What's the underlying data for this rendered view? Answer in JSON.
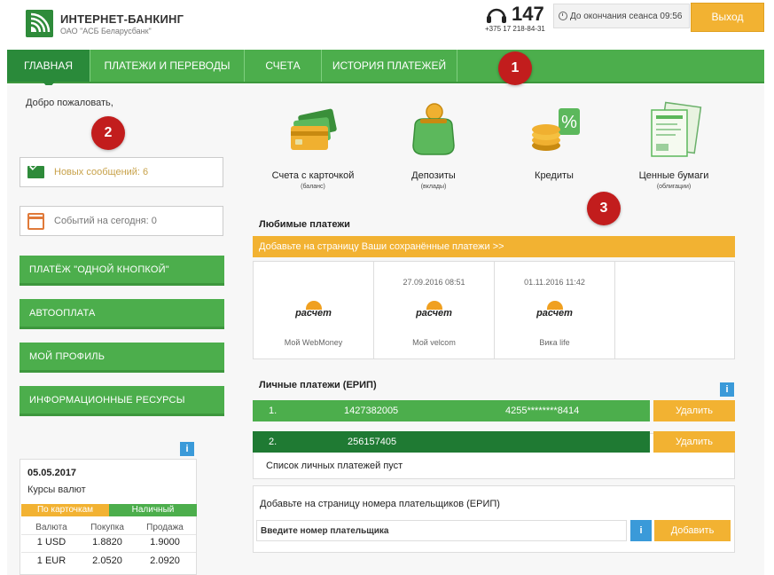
{
  "header": {
    "brand_title": "ИНТЕРНЕТ-БАНКИНГ",
    "brand_subtitle": "ОАО \"АСБ Беларусбанк\"",
    "phone_short": "147",
    "phone_full": "+375 17 218-84-31",
    "session_label": "До окончания сеанса 09:56",
    "logout_label": "Выход"
  },
  "nav": {
    "items": [
      {
        "label": "ГЛАВНАЯ",
        "active": true
      },
      {
        "label": "ПЛАТЕЖИ И ПЕРЕВОДЫ"
      },
      {
        "label": "СЧЕТА"
      },
      {
        "label": "ИСТОРИЯ ПЛАТЕЖЕЙ"
      }
    ]
  },
  "annotations": [
    "1",
    "2",
    "3"
  ],
  "sidebar": {
    "welcome": "Добро пожаловать,",
    "messages": "Новых сообщений: 6",
    "events": "Событий на сегодня: 0",
    "buttons": [
      "ПЛАТЁЖ \"ОДНОЙ КНОПКОЙ\"",
      "АВТООПЛАТА",
      "МОЙ ПРОФИЛЬ",
      "ИНФОРМАЦИОННЫЕ РЕСУРСЫ"
    ],
    "info_label": "i"
  },
  "currency": {
    "date": "05.05.2017",
    "title": "Курсы валют",
    "tab_card": "По карточкам",
    "tab_cash": "Наличный",
    "headers": [
      "Валюта",
      "Покупка",
      "Продажа"
    ],
    "rows": [
      {
        "cur": "1 USD",
        "buy": "1.8820",
        "sell": "1.9000"
      },
      {
        "cur": "1 EUR",
        "buy": "2.0520",
        "sell": "2.0920"
      }
    ]
  },
  "products": [
    {
      "label": "Счета с карточкой",
      "sub": "(баланс)",
      "icon": "credit-cards-icon"
    },
    {
      "label": "Депозиты",
      "sub": "(вклады)",
      "icon": "coin-purse-icon"
    },
    {
      "label": "Кредиты",
      "sub": "",
      "icon": "coins-percent-icon"
    },
    {
      "label": "Ценные бумаги",
      "sub": "(облигации)",
      "icon": "securities-icon"
    }
  ],
  "favorites": {
    "title": "Любимые платежи",
    "add_bar": "Добавьте на страницу Ваши сохранённые платежи >>",
    "logo_text": "расчет",
    "items": [
      {
        "date": "",
        "name": "Мой WebMoney"
      },
      {
        "date": "27.09.2016 08:51",
        "name": "Мой velcom"
      },
      {
        "date": "01.11.2016 11:42",
        "name": "Вика life"
      }
    ]
  },
  "erip": {
    "title": "Личные платежи (ЕРИП)",
    "rows": [
      {
        "num": "1.",
        "id": "1427382005",
        "card": "4255********8414",
        "delete": "Удалить"
      },
      {
        "num": "2.",
        "id": "256157405",
        "card": "",
        "delete": "Удалить"
      }
    ],
    "empty_text": "Список личных платежей пуст",
    "add_title": "Добавьте на страницу номера плательщиков (ЕРИП)",
    "input_placeholder": "Введите номер плательщика",
    "add_button": "Добавить",
    "info_label": "i"
  },
  "colors": {
    "green": "#4cae4c",
    "dark_green": "#2a8a3a",
    "orange": "#f2b232",
    "annotation_red": "#c21d1d",
    "info_blue": "#3a9ad9"
  }
}
